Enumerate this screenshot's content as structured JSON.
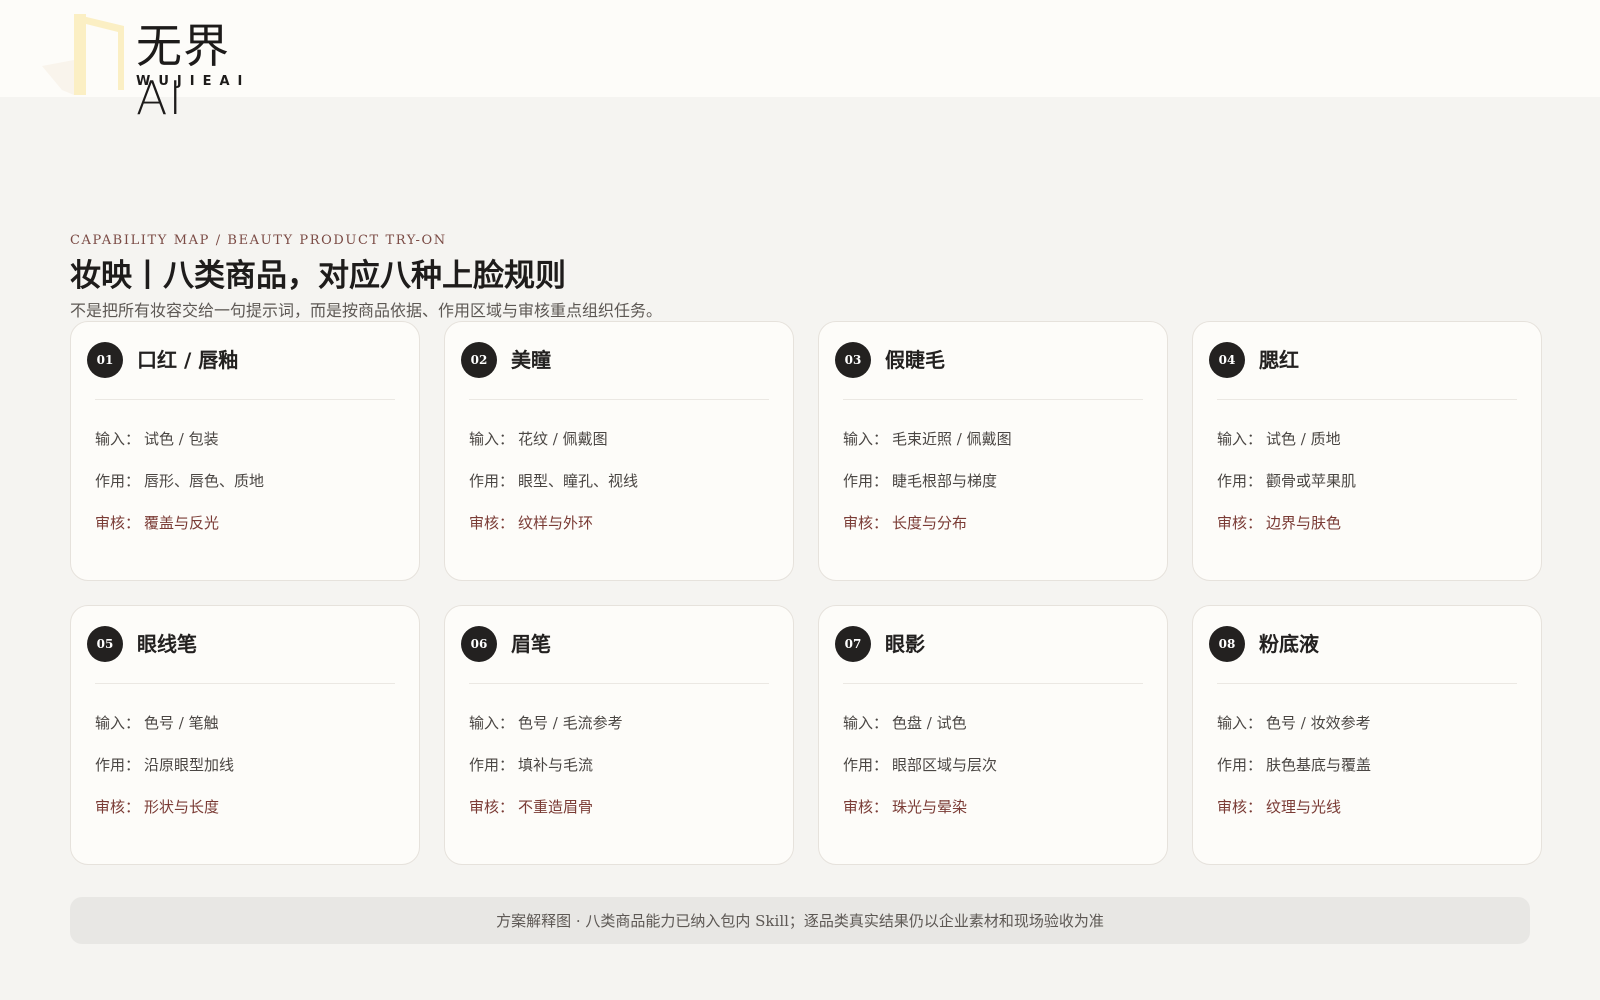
{
  "header": {
    "logo_text": "无界AI",
    "logo_sub": "WUJIEAI",
    "logo_accent": "#fbefc4"
  },
  "hero": {
    "eyebrow": "CAPABILITY MAP / BEAUTY PRODUCT TRY-ON",
    "title": "妆映丨八类商品，对应八种上脸规则",
    "subtitle": "不是把所有妆容交给一句提示词，而是按商品依据、作用区域与审核重点组织任务。"
  },
  "labels": {
    "input": "输入：",
    "effect": "作用：",
    "review": "审核："
  },
  "cards": [
    {
      "num": "01",
      "title": "口红 / 唇釉",
      "input": "试色 / 包装",
      "effect": "唇形、唇色、质地",
      "review": "覆盖与反光"
    },
    {
      "num": "02",
      "title": "美瞳",
      "input": "花纹 / 佩戴图",
      "effect": "眼型、瞳孔、视线",
      "review": "纹样与外环"
    },
    {
      "num": "03",
      "title": "假睫毛",
      "input": "毛束近照 / 佩戴图",
      "effect": "睫毛根部与梯度",
      "review": "长度与分布"
    },
    {
      "num": "04",
      "title": "腮红",
      "input": "试色 / 质地",
      "effect": "颧骨或苹果肌",
      "review": "边界与肤色"
    },
    {
      "num": "05",
      "title": "眼线笔",
      "input": "色号 / 笔触",
      "effect": "沿原眼型加线",
      "review": "形状与长度"
    },
    {
      "num": "06",
      "title": "眉笔",
      "input": "色号 / 毛流参考",
      "effect": "填补与毛流",
      "review": "不重造眉骨"
    },
    {
      "num": "07",
      "title": "眼影",
      "input": "色盘 / 试色",
      "effect": "眼部区域与层次",
      "review": "珠光与晕染"
    },
    {
      "num": "08",
      "title": "粉底液",
      "input": "色号 / 妆效参考",
      "effect": "肤色基底与覆盖",
      "review": "纹理与光线"
    }
  ],
  "footer": {
    "text": "方案解释图 · 八类商品能力已纳入包内 Skill；逐品类真实结果仍以企业素材和现场验收为准"
  },
  "colors": {
    "accent": "#7a3b35",
    "badge": "#232120",
    "background": "#f5f4f1",
    "card": "#fdfcf9"
  }
}
